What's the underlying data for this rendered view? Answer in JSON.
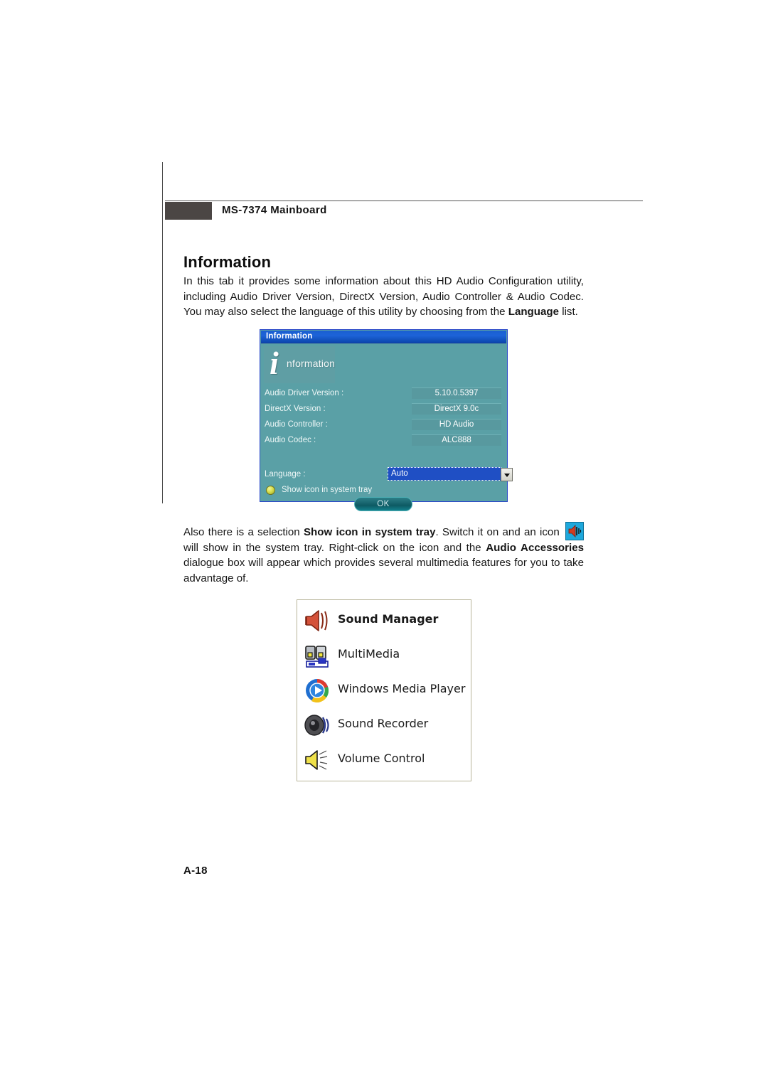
{
  "document": {
    "header_title": "MS-7374 Mainboard",
    "section_title": "Information",
    "page_number": "A-18",
    "paragraph_intro_parts": [
      "In this tab it provides some information about this HD Audio Configuration utility, including Audio Driver Version, DirectX Version, Audio Controller & Audio Codec. You may also select the language of this utility by choosing from the ",
      "Language",
      " list."
    ],
    "paragraph_tray_parts": [
      "Also there is a selection ",
      "Show icon in system tray",
      ". Switch it on and an icon ",
      " will show in the system tray. Right-click on the icon and the ",
      "Audio Accessories",
      " dialogue box will appear which provides several multimedia features for you to take advantage of."
    ]
  },
  "dialog": {
    "title": "Information",
    "banner": {
      "initial": "i",
      "word": "nformation"
    },
    "fields": [
      {
        "label": "Audio Driver Version :",
        "value": "5.10.0.5397"
      },
      {
        "label": "DirectX Version :",
        "value": "DirectX 9.0c"
      },
      {
        "label": "Audio Controller :",
        "value": "HD Audio"
      },
      {
        "label": "Audio Codec :",
        "value": "ALC888"
      }
    ],
    "language": {
      "label": "Language :",
      "selected": "Auto",
      "options": [
        "Auto"
      ]
    },
    "tray_checkbox_label": "Show icon in system tray",
    "ok_label": "OK"
  },
  "accessories_menu": {
    "items": [
      {
        "label": "Sound Manager",
        "icon": "speaker-red-icon",
        "bold": true
      },
      {
        "label": "MultiMedia",
        "icon": "multimedia-icon",
        "bold": false
      },
      {
        "label": "Windows Media Player",
        "icon": "windows-media-player-icon",
        "bold": false
      },
      {
        "label": "Sound Recorder",
        "icon": "sound-recorder-icon",
        "bold": false
      },
      {
        "label": "Volume Control",
        "icon": "volume-control-icon",
        "bold": false
      }
    ]
  },
  "colors": {
    "dialog_background": "#5aa0a6",
    "dialog_titlebar": "#1a5fd0",
    "dialog_border": "#2a48c8",
    "select_highlight": "#1f4fc4",
    "header_block": "#4b4644",
    "accessories_border": "#b9b59a"
  }
}
